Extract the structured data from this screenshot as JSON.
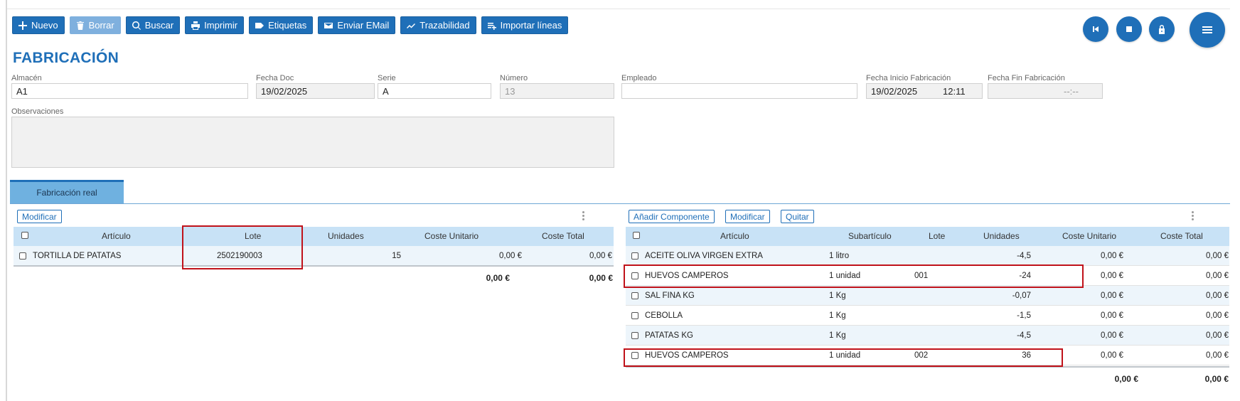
{
  "toolbar": {
    "nuevo": "Nuevo",
    "borrar": "Borrar",
    "buscar": "Buscar",
    "imprimir": "Imprimir",
    "etiquetas": "Etiquetas",
    "enviar_email": "Enviar EMail",
    "trazabilidad": "Trazabilidad",
    "importar": "Importar líneas"
  },
  "title": "FABRICACIÓN",
  "form": {
    "almacen_label": "Almacén",
    "almacen_value": "A1",
    "fecha_doc_label": "Fecha Doc",
    "fecha_doc_value": "19/02/2025",
    "serie_label": "Serie",
    "serie_value": "A",
    "numero_label": "Número",
    "numero_value": "13",
    "empleado_label": "Empleado",
    "empleado_value": "",
    "fecha_inicio_label": "Fecha Inicio Fabricación",
    "fecha_inicio_date": "19/02/2025",
    "fecha_inicio_time": "12:11",
    "fecha_fin_label": "Fecha Fin Fabricación",
    "fecha_fin_date": "",
    "fecha_fin_time": "--:--",
    "observaciones_label": "Observaciones",
    "observaciones_value": ""
  },
  "tab": "Fabricación real",
  "left": {
    "modificar": "Modificar",
    "headers": {
      "articulo": "Artículo",
      "lote": "Lote",
      "unidades": "Unidades",
      "coste_unitario": "Coste Unitario",
      "coste_total": "Coste Total"
    },
    "rows": [
      {
        "articulo": "TORTILLA DE PATATAS",
        "lote": "2502190003",
        "unidades": "15",
        "coste_unitario": "0,00 €",
        "coste_total": "0,00 €"
      }
    ],
    "total_unitario": "0,00 €",
    "total_total": "0,00 €"
  },
  "right": {
    "anadir": "Añadir Componente",
    "modificar": "Modificar",
    "quitar": "Quitar",
    "headers": {
      "articulo": "Artículo",
      "subarticulo": "Subartículo",
      "lote": "Lote",
      "unidades": "Unidades",
      "coste_unitario": "Coste Unitario",
      "coste_total": "Coste Total"
    },
    "rows": [
      {
        "articulo": "ACEITE OLIVA VIRGEN EXTRA",
        "subarticulo": "1 litro",
        "lote": "",
        "unidades": "-4,5",
        "coste_unitario": "0,00 €",
        "coste_total": "0,00 €"
      },
      {
        "articulo": "HUEVOS CAMPEROS",
        "subarticulo": "1 unidad",
        "lote": "001",
        "unidades": "-24",
        "coste_unitario": "0,00 €",
        "coste_total": "0,00 €"
      },
      {
        "articulo": "SAL FINA KG",
        "subarticulo": "1 Kg",
        "lote": "",
        "unidades": "-0,07",
        "coste_unitario": "0,00 €",
        "coste_total": "0,00 €"
      },
      {
        "articulo": "CEBOLLA",
        "subarticulo": "1 Kg",
        "lote": "",
        "unidades": "-1,5",
        "coste_unitario": "0,00 €",
        "coste_total": "0,00 €"
      },
      {
        "articulo": "PATATAS KG",
        "subarticulo": "1 Kg",
        "lote": "",
        "unidades": "-4,5",
        "coste_unitario": "0,00 €",
        "coste_total": "0,00 €"
      },
      {
        "articulo": "HUEVOS CAMPEROS",
        "subarticulo": "1 unidad",
        "lote": "002",
        "unidades": "36",
        "coste_unitario": "0,00 €",
        "coste_total": "0,00 €"
      }
    ],
    "total_unitario": "0,00 €",
    "total_total": "0,00 €"
  },
  "colors": {
    "primary": "#1f6fb8",
    "header_bg": "#c8e2f6",
    "highlight": "#c0121a"
  }
}
